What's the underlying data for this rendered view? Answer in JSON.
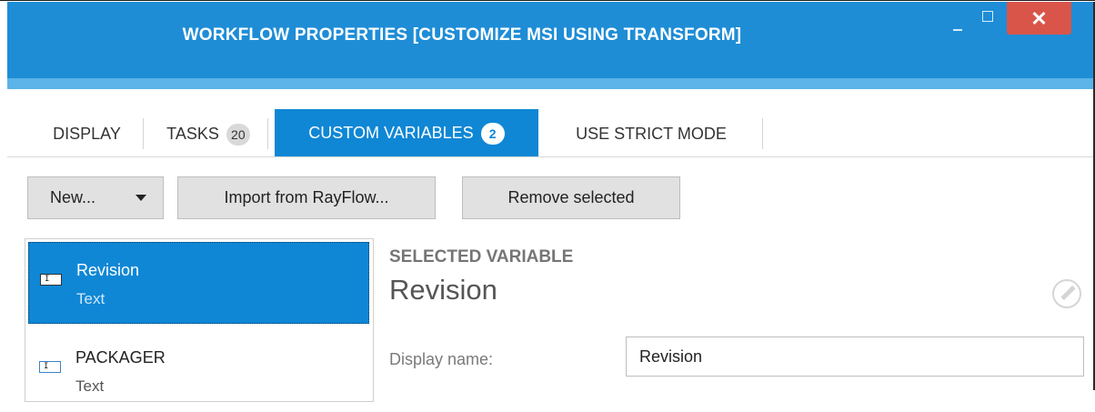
{
  "window": {
    "title": "WORKFLOW PROPERTIES [CUSTOMIZE MSI USING TRANSFORM]",
    "controls": {
      "minimize_glyph": "minimize-icon",
      "maximize_glyph": "maximize-icon",
      "close_glyph": "✕"
    }
  },
  "tabs": [
    {
      "label": "DISPLAY",
      "badge": null,
      "active": false
    },
    {
      "label": "TASKS",
      "badge": "20",
      "active": false
    },
    {
      "label": "CUSTOM VARIABLES",
      "badge": "2",
      "active": true
    },
    {
      "label": "USE STRICT MODE",
      "badge": null,
      "active": false
    }
  ],
  "toolbar": {
    "new_label": "New...",
    "import_label": "Import from RayFlow...",
    "remove_label": "Remove selected"
  },
  "variables": [
    {
      "name": "Revision",
      "type": "Text",
      "selected": true,
      "icon": "text-variable-icon"
    },
    {
      "name": "PACKAGER",
      "type": "Text",
      "selected": false,
      "icon": "text-variable-icon"
    }
  ],
  "details": {
    "heading": "SELECTED VARIABLE",
    "name": "Revision",
    "display_name_label": "Display name:",
    "display_name_value": "Revision"
  },
  "colors": {
    "titlebar": "#1e8dd6",
    "accent": "#0f87d5",
    "close": "#d9554a"
  }
}
